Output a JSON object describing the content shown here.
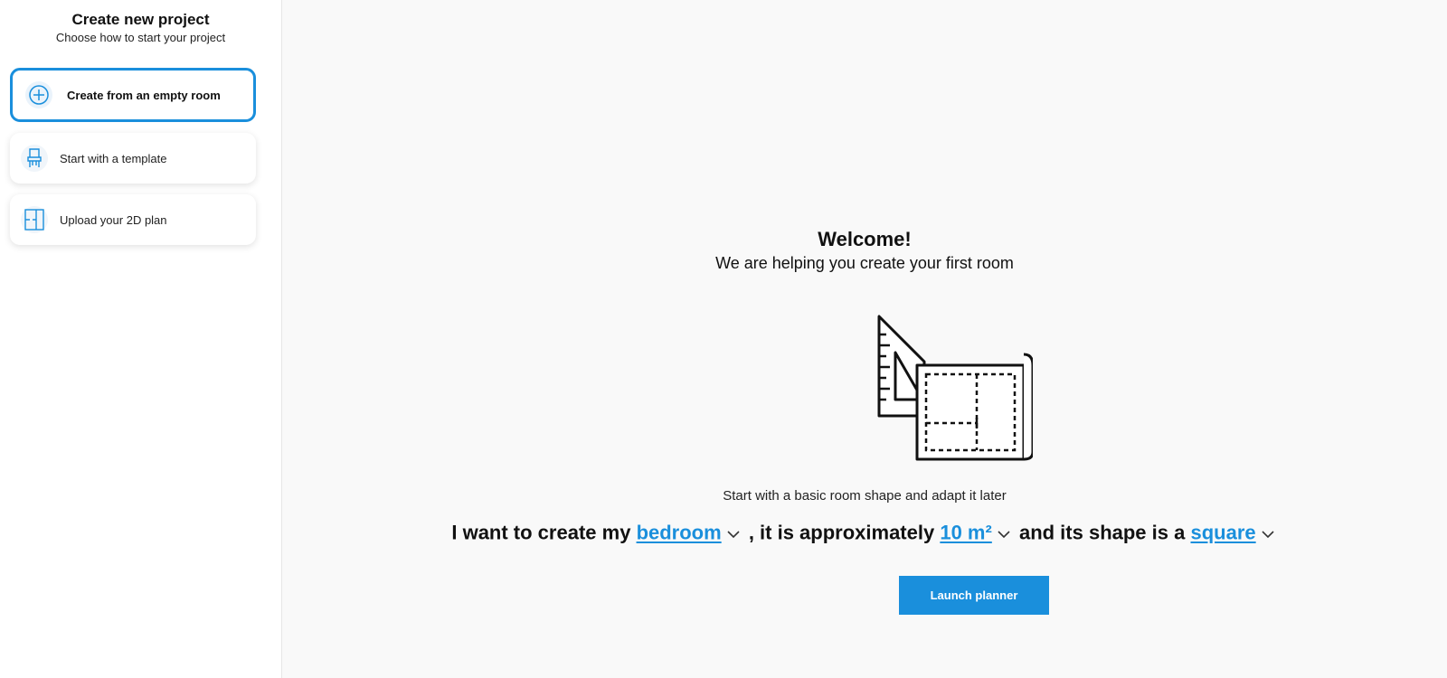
{
  "sidebar": {
    "title": "Create new project",
    "subtitle": "Choose how to start your project",
    "options": [
      {
        "label": "Create from an empty room",
        "icon": "plus-circle-icon",
        "selected": true
      },
      {
        "label": "Start with a template",
        "icon": "chair-icon",
        "selected": false
      },
      {
        "label": "Upload your 2D plan",
        "icon": "floor-plan-icon",
        "selected": false
      }
    ]
  },
  "main": {
    "welcome_title": "Welcome!",
    "welcome_subtitle": "We are helping you create your first room",
    "illustration_icon": "room-plan-illustration",
    "hint": "Start with a basic room shape and adapt it later",
    "sentence": {
      "part1": "I want to create my",
      "room_type": "bedroom",
      "part2": ", it is approximately",
      "area": "10 m²",
      "part3": "and its shape is a",
      "shape": "square"
    },
    "launch_label": "Launch planner"
  },
  "colors": {
    "accent": "#1a8fdc",
    "background": "#f9f9f9"
  }
}
